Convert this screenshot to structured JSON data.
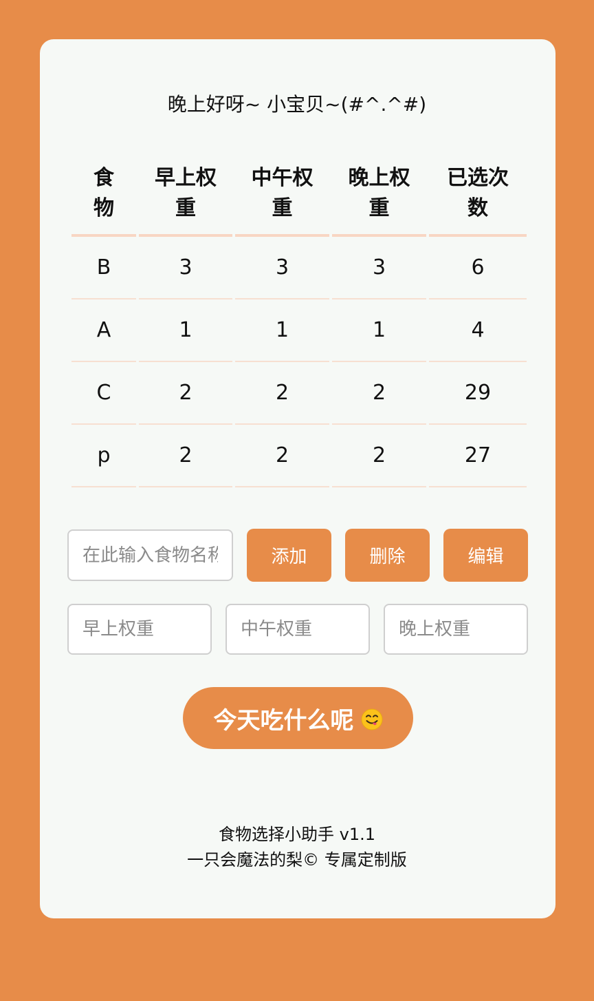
{
  "greeting": "晚上好呀~ 小宝贝~(#^.^#)",
  "table": {
    "headers": [
      "食物",
      "早上权重",
      "中午权重",
      "晚上权重",
      "已选次数"
    ],
    "rows": [
      [
        "B",
        "3",
        "3",
        "3",
        "6"
      ],
      [
        "A",
        "1",
        "1",
        "1",
        "4"
      ],
      [
        "C",
        "2",
        "2",
        "2",
        "29"
      ],
      [
        "p",
        "2",
        "2",
        "2",
        "27"
      ]
    ]
  },
  "form": {
    "food_name_placeholder": "在此输入食物名称",
    "add_label": "添加",
    "delete_label": "删除",
    "edit_label": "编辑",
    "morning_placeholder": "早上权重",
    "noon_placeholder": "中午权重",
    "evening_placeholder": "晚上权重"
  },
  "main_button": {
    "label": "今天吃什么呢",
    "icon": "yum-face-emoji"
  },
  "footer": {
    "line1": "食物选择小助手 v1.1",
    "line2": "一只会魔法的梨© 专属定制版"
  },
  "colors": {
    "accent": "#e78c49",
    "card_background": "#f6f9f6",
    "table_divider": "#f8d6c3"
  }
}
